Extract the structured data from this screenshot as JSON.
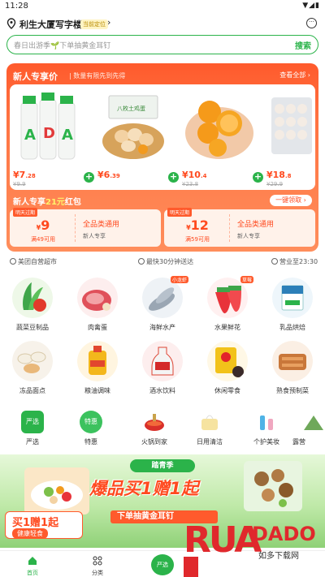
{
  "status": {
    "time": "11:28"
  },
  "header": {
    "location": "利生大厦写字楼",
    "current_badge": "当前定位",
    "chevron": "›"
  },
  "search": {
    "placeholder": "春日出游季🌱下单抽黄金耳钉",
    "button": "搜索"
  },
  "newuser": {
    "title": "新人专享价",
    "subtitle": "| 数量有限先到先得",
    "view_all": "查看全部 ›",
    "products": [
      {
        "price_int": "7",
        "price_dec": ".28",
        "orig": "¥9.9"
      },
      {
        "price_int": "6",
        "price_dec": ".39",
        "orig": ""
      },
      {
        "price_int": "10",
        "price_dec": ".4",
        "orig": "¥23.8"
      },
      {
        "price_int": "18",
        "price_dec": ".8",
        "orig": "¥29.9"
      }
    ]
  },
  "redpacket": {
    "title_prefix": "新人专享",
    "title_amount": "21元",
    "title_suffix": "红包",
    "claim_button": "一键领取 ›",
    "coupons": [
      {
        "tag": "明天过期",
        "amount": "9",
        "condition": "满49可用",
        "scope": "全品类通用",
        "target": "新人专享"
      },
      {
        "tag": "明天过期",
        "amount": "12",
        "condition": "满59可用",
        "scope": "全品类通用",
        "target": "新人专享"
      }
    ]
  },
  "info_row": {
    "store": "美团自营超市",
    "delivery": "最快30分钟送达",
    "hours": "营业至23:30"
  },
  "categories": [
    {
      "label": "蔬菜豆制品",
      "tag": ""
    },
    {
      "label": "肉禽蛋",
      "tag": ""
    },
    {
      "label": "海鲜水产",
      "tag": "小龙虾"
    },
    {
      "label": "水果鲜花",
      "tag": "草莓"
    },
    {
      "label": "乳品烘焙",
      "tag": ""
    },
    {
      "label": "冻品面点",
      "tag": ""
    },
    {
      "label": "粮油调味",
      "tag": ""
    },
    {
      "label": "酒水饮料",
      "tag": ""
    },
    {
      "label": "休闲零食",
      "tag": ""
    },
    {
      "label": "熟食预制菜",
      "tag": ""
    }
  ],
  "channels": [
    {
      "label": "严选",
      "icon_text": "严选"
    },
    {
      "label": "特惠",
      "icon_text": "特惠"
    },
    {
      "label": "火锅到家",
      "icon_text": ""
    },
    {
      "label": "日用清洁",
      "icon_text": ""
    },
    {
      "label": "个护美妆",
      "icon_text": ""
    },
    {
      "label": "露营",
      "icon_text": ""
    }
  ],
  "banner": {
    "season": "踏青季",
    "headline": "爆品买1赠1起",
    "strip": "下单抽黄金耳钉",
    "card_title": "买1赠1起",
    "card_sub": "健康轻食"
  },
  "tabbar": {
    "home": "首页",
    "category": "分类",
    "center_icon_text": "严选"
  },
  "watermark": {
    "text": "RUANDADO",
    "sub": "如多下载网"
  },
  "colors": {
    "brand_green": "#2bb34a",
    "promo_orange": "#ff5a2c",
    "price_red": "#ff4a1f"
  }
}
